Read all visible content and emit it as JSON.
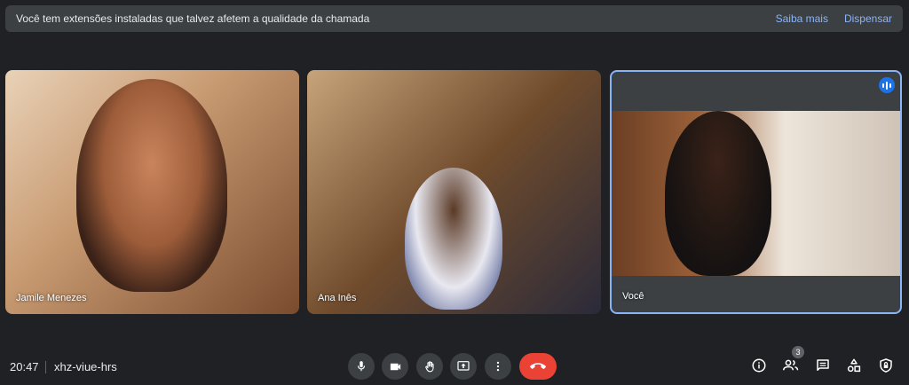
{
  "banner": {
    "message": "Você tem extensões instaladas que talvez afetem a qualidade da chamada",
    "learn_more": "Saiba mais",
    "dismiss": "Dispensar"
  },
  "participants": [
    {
      "name": "Jamile Menezes"
    },
    {
      "name": "Ana Inês"
    },
    {
      "name": "Você",
      "speaking": true
    }
  ],
  "meeting": {
    "time": "20:47",
    "code": "xhz-viue-hrs"
  },
  "people_count": "3",
  "colors": {
    "background": "#202124",
    "accent": "#8ab4f8",
    "end_call": "#ea4335"
  }
}
